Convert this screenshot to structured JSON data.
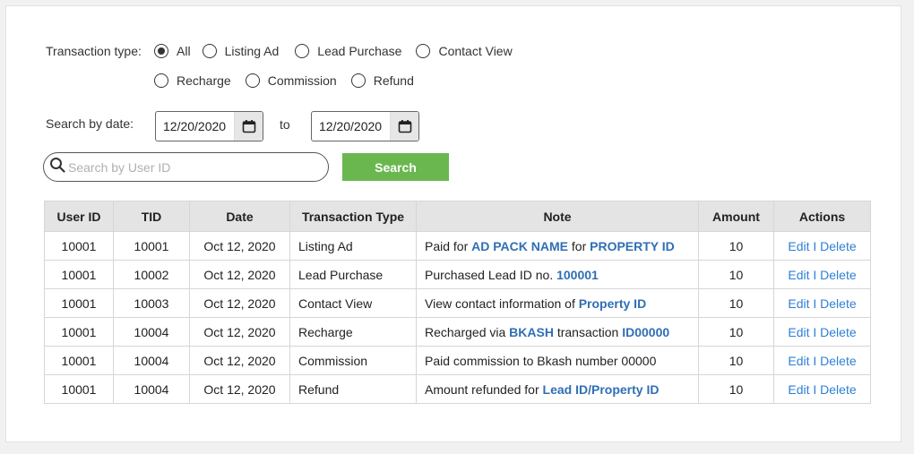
{
  "filters": {
    "transaction_type_label": "Transaction type:",
    "options": [
      "All",
      "Listing Ad",
      "Lead Purchase",
      "Contact View",
      "Recharge",
      "Commission",
      "Refund"
    ],
    "selected": "All",
    "date_label": "Search by date:",
    "date_from": "12/20/2020",
    "date_to": "12/20/2020",
    "to_label": "to"
  },
  "search": {
    "placeholder": "Search by User ID",
    "button_label": "Search"
  },
  "colors": {
    "search_button": "#6ab74f",
    "highlight_text": "#2f6fb5",
    "action_link": "#2f7fd4"
  },
  "table": {
    "headers": [
      "User ID",
      "TID",
      "Date",
      "Transaction Type",
      "Note",
      "Amount",
      "Actions"
    ],
    "rows": [
      {
        "user_id": "10001",
        "tid": "10001",
        "date": "Oct 12, 2020",
        "type": "Listing Ad",
        "note": [
          {
            "t": "Paid for "
          },
          {
            "t": "AD PACK NAME",
            "b": true
          },
          {
            "t": " for "
          },
          {
            "t": "PROPERTY ID",
            "b": true
          }
        ],
        "amount": "10"
      },
      {
        "user_id": "10001",
        "tid": "10002",
        "date": "Oct 12, 2020",
        "type": "Lead Purchase",
        "note": [
          {
            "t": "Purchased Lead ID no. "
          },
          {
            "t": "100001",
            "b": true
          }
        ],
        "amount": "10"
      },
      {
        "user_id": "10001",
        "tid": "10003",
        "date": "Oct 12, 2020",
        "type": "Contact View",
        "note": [
          {
            "t": "View contact information of "
          },
          {
            "t": "Property ID",
            "b": true
          }
        ],
        "amount": "10"
      },
      {
        "user_id": "10001",
        "tid": "10004",
        "date": "Oct 12, 2020",
        "type": "Recharge",
        "note": [
          {
            "t": "Recharged via "
          },
          {
            "t": "BKASH",
            "b": true
          },
          {
            "t": " transaction "
          },
          {
            "t": "ID00000",
            "b": true
          }
        ],
        "amount": "10"
      },
      {
        "user_id": "10001",
        "tid": "10004",
        "date": "Oct 12, 2020",
        "type": "Commission",
        "note": [
          {
            "t": "Paid commission to Bkash number 00000"
          }
        ],
        "amount": "10"
      },
      {
        "user_id": "10001",
        "tid": "10004",
        "date": "Oct 12, 2020",
        "type": "Refund",
        "note": [
          {
            "t": "Amount refunded for "
          },
          {
            "t": "Lead ID/Property ID",
            "b": true
          }
        ],
        "amount": "10"
      }
    ],
    "actions": {
      "edit": "Edit",
      "separator": " I ",
      "delete": "Delete"
    }
  }
}
